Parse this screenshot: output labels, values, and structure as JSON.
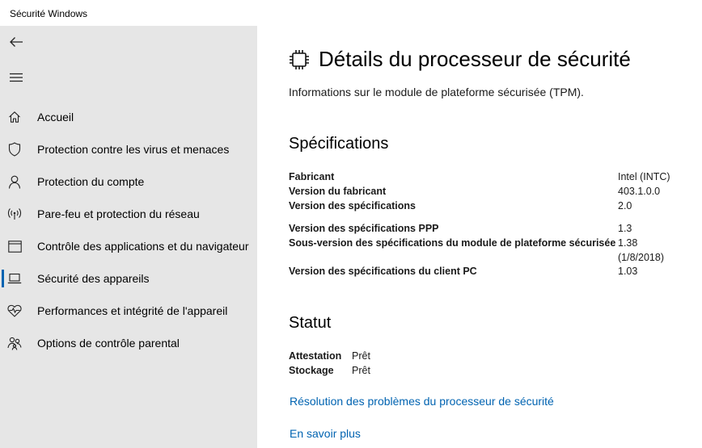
{
  "window": {
    "title": "Sécurité Windows"
  },
  "sidebar": {
    "items": [
      {
        "label": "Accueil",
        "icon": "home-icon",
        "selected": false
      },
      {
        "label": "Protection contre les virus et menaces",
        "icon": "shield-icon",
        "selected": false
      },
      {
        "label": "Protection du compte",
        "icon": "person-icon",
        "selected": false
      },
      {
        "label": "Pare-feu et protection du réseau",
        "icon": "wireless-icon",
        "selected": false
      },
      {
        "label": "Contrôle des applications et du navigateur",
        "icon": "browser-window-icon",
        "selected": false
      },
      {
        "label": "Sécurité des appareils",
        "icon": "laptop-icon",
        "selected": true
      },
      {
        "label": "Performances et intégrité de l'appareil",
        "icon": "heart-pulse-icon",
        "selected": false
      },
      {
        "label": "Options de contrôle parental",
        "icon": "family-icon",
        "selected": false
      }
    ]
  },
  "main": {
    "title": "Détails du processeur de sécurité",
    "subtitle": "Informations sur le module de plateforme sécurisée (TPM).",
    "specs": {
      "heading": "Spécifications",
      "rows": [
        {
          "label": "Fabricant",
          "value": "Intel (INTC)"
        },
        {
          "label": "Version du fabricant",
          "value": "403.1.0.0"
        },
        {
          "label": "Version des spécifications",
          "value": "2.0"
        },
        {
          "label": "Version des spécifications PPP",
          "value": "1.3"
        },
        {
          "label": "Sous-version des spécifications du module de plateforme sécurisée",
          "value": "1.38",
          "value_line2": "(1/8/2018)"
        },
        {
          "label": "Version des spécifications du client PC",
          "value": "1.03"
        }
      ]
    },
    "status": {
      "heading": "Statut",
      "rows": [
        {
          "label": "Attestation",
          "value": "Prêt"
        },
        {
          "label": "Stockage",
          "value": "Prêt"
        }
      ]
    },
    "links": {
      "troubleshoot": "Résolution des problèmes du processeur de sécurité",
      "learn_more": "En savoir plus"
    }
  },
  "colors": {
    "accent": "#0063b1",
    "sidebar_bg": "#e6e6e6"
  }
}
